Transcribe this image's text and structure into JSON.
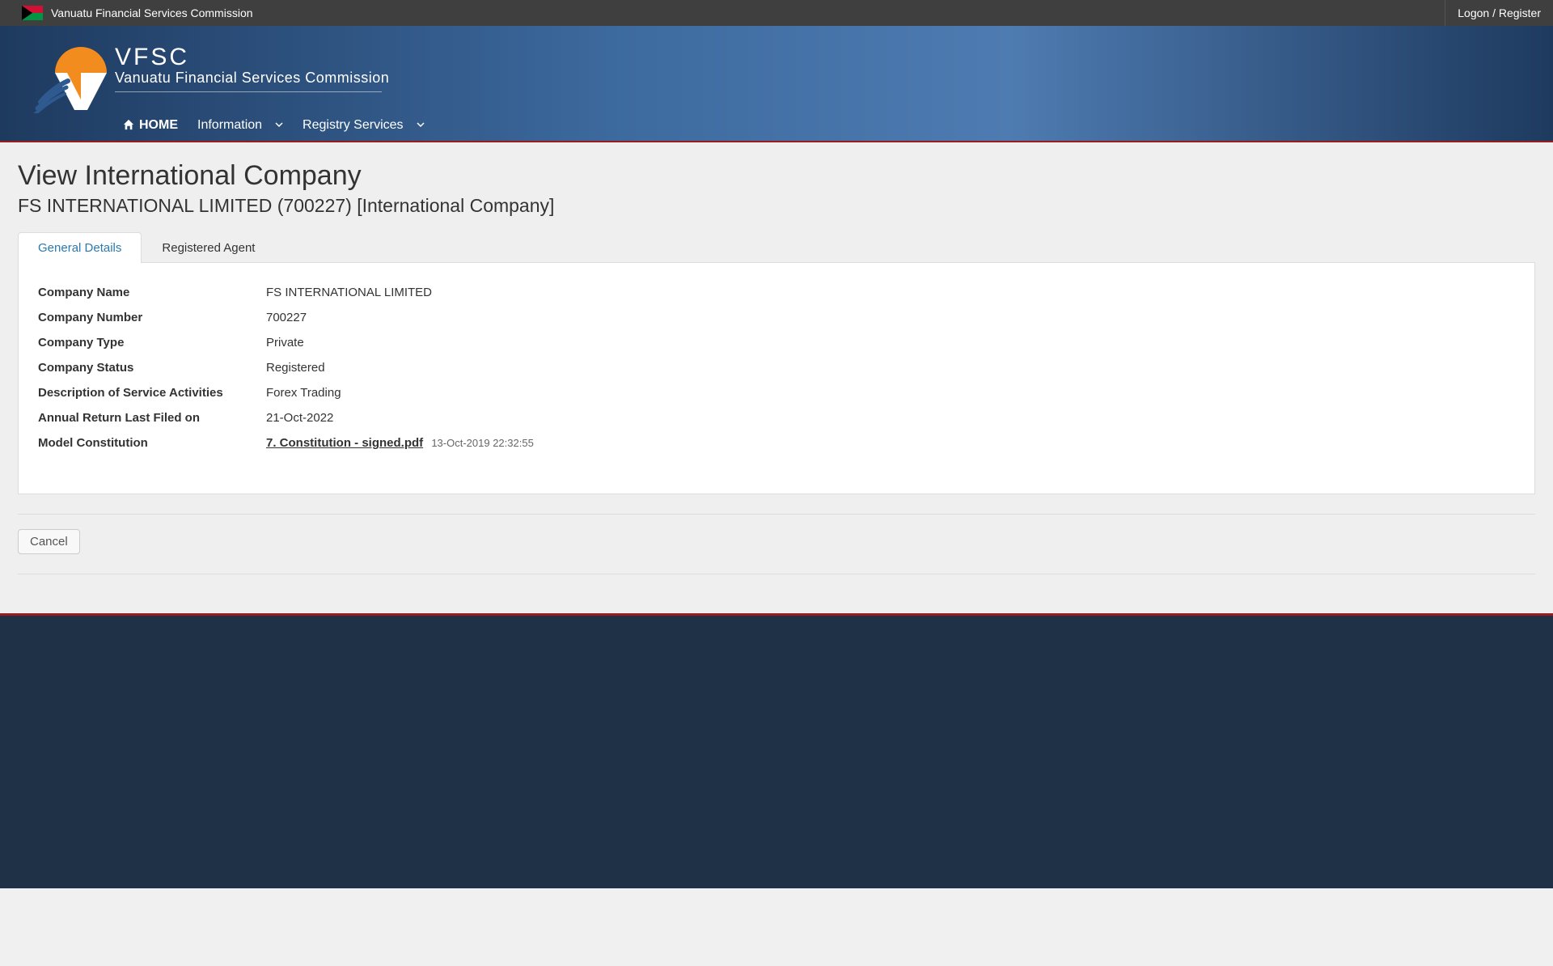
{
  "topbar": {
    "title": "Vanuatu Financial Services Commission",
    "login_label": "Logon / Register"
  },
  "brand": {
    "acronym": "VFSC",
    "full": "Vanuatu Financial Services Commission"
  },
  "nav": {
    "home": "HOME",
    "information": "Information",
    "registry": "Registry Services"
  },
  "page": {
    "title": "View International Company",
    "subtitle": "FS INTERNATIONAL LIMITED (700227) [International Company]"
  },
  "tabs": {
    "general": "General Details",
    "agent": "Registered Agent"
  },
  "details": {
    "company_name_label": "Company Name",
    "company_name_value": "FS INTERNATIONAL LIMITED",
    "company_number_label": "Company Number",
    "company_number_value": "700227",
    "company_type_label": "Company Type",
    "company_type_value": "Private",
    "company_status_label": "Company Status",
    "company_status_value": "Registered",
    "service_activities_label": "Description of Service Activities",
    "service_activities_value": "Forex Trading",
    "annual_return_label": "Annual Return Last Filed on",
    "annual_return_value": "21-Oct-2022",
    "model_constitution_label": "Model Constitution",
    "model_constitution_file": "7. Constitution - signed.pdf",
    "model_constitution_date": "13-Oct-2019 22:32:55"
  },
  "buttons": {
    "cancel": "Cancel"
  }
}
